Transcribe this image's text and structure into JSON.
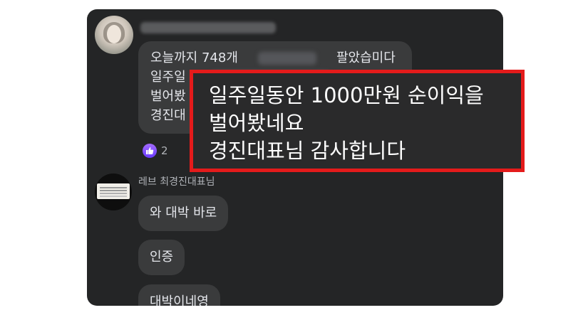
{
  "thread": {
    "comment1": {
      "lines": [
        "오늘까지 748개",
        "팔았습미다",
        "일주일",
        "벌어봤",
        "경진대"
      ],
      "reaction_count": "2"
    },
    "comment2": {
      "author": "레브 최경진대표님",
      "replies": [
        "와 대박 바로",
        "인증",
        "대박이네영"
      ]
    }
  },
  "callout": {
    "lines": [
      "일주일동안 1000만원 순이익을",
      "벌어봤네요",
      "경진대표님 감사합니다"
    ],
    "border_color": "#e41b1b"
  },
  "icons": {
    "like": "thumbs-up-icon"
  }
}
